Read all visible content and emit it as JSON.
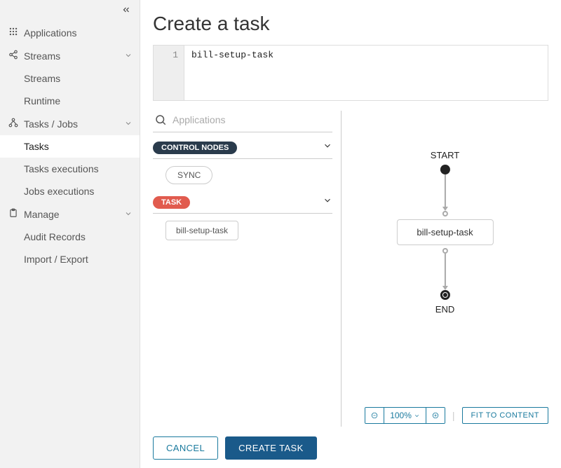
{
  "sidebar": {
    "items": [
      {
        "label": "Applications",
        "icon": "grid",
        "hasChildren": false
      },
      {
        "label": "Streams",
        "icon": "share",
        "hasChildren": true,
        "children": [
          {
            "label": "Streams"
          },
          {
            "label": "Runtime"
          }
        ]
      },
      {
        "label": "Tasks / Jobs",
        "icon": "cluster",
        "hasChildren": true,
        "children": [
          {
            "label": "Tasks",
            "active": true
          },
          {
            "label": "Tasks executions"
          },
          {
            "label": "Jobs executions"
          }
        ]
      },
      {
        "label": "Manage",
        "icon": "clipboard",
        "hasChildren": true,
        "children": [
          {
            "label": "Audit Records"
          },
          {
            "label": "Import / Export"
          }
        ]
      }
    ]
  },
  "page": {
    "title": "Create a task"
  },
  "editor": {
    "lineNumber": "1",
    "code": "bill-setup-task"
  },
  "palette": {
    "searchPlaceholder": "Applications",
    "sections": [
      {
        "label": "CONTROL NODES",
        "badgeClass": "dark",
        "items": [
          "SYNC"
        ],
        "chipClass": ""
      },
      {
        "label": "TASK",
        "badgeClass": "red",
        "items": [
          "bill-setup-task"
        ],
        "chipClass": "square"
      }
    ]
  },
  "flow": {
    "startLabel": "START",
    "endLabel": "END",
    "taskLabel": "bill-setup-task"
  },
  "zoom": {
    "level": "100%"
  },
  "controls": {
    "fitLabel": "FIT TO CONTENT"
  },
  "footer": {
    "cancel": "CANCEL",
    "create": "CREATE TASK"
  }
}
